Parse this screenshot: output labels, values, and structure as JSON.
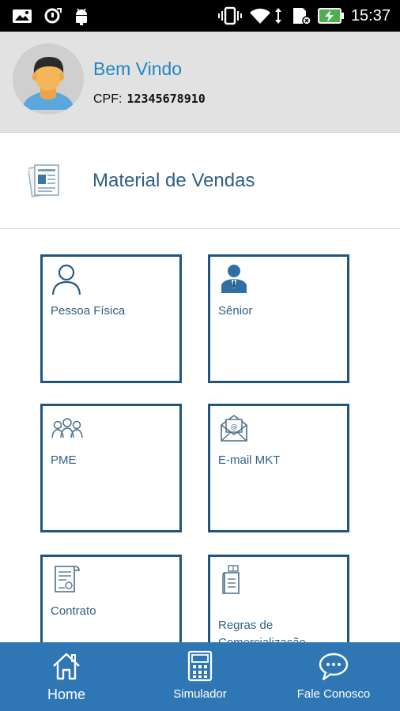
{
  "status_bar": {
    "time": "15:37",
    "icons": [
      "image-icon",
      "sync-icon",
      "android-icon",
      "vibrate-icon",
      "wifi-icon",
      "data-arrows-icon",
      "sd-card-icon",
      "battery-charging-icon"
    ]
  },
  "profile": {
    "welcome": "Bem Vindo",
    "cpf_label": "CPF:",
    "cpf_value": "12345678910",
    "avatar_icon": "user-avatar-icon"
  },
  "material": {
    "label": "Material de Vendas",
    "icon": "documents-icon"
  },
  "tiles": [
    {
      "label": "Pessoa Física",
      "icon": "person-outline-icon"
    },
    {
      "label": "Sênior",
      "icon": "business-person-icon"
    },
    {
      "label": "PME",
      "icon": "group-icon"
    },
    {
      "label": "E-mail MKT",
      "icon": "email-icon"
    },
    {
      "label": "Contrato",
      "icon": "contract-icon"
    },
    {
      "label": "Regras de Comercialização",
      "icon": "rules-book-icon"
    }
  ],
  "bottom_nav": [
    {
      "label": "Home",
      "icon": "home-icon"
    },
    {
      "label": "Simulador",
      "icon": "calculator-icon"
    },
    {
      "label": "Fale Conosco",
      "icon": "chat-icon"
    }
  ],
  "colors": {
    "accent": "#2386c0",
    "tile_border": "#20567d",
    "nav_bg": "#2f77b4",
    "header_bg": "#e2e2e2"
  }
}
